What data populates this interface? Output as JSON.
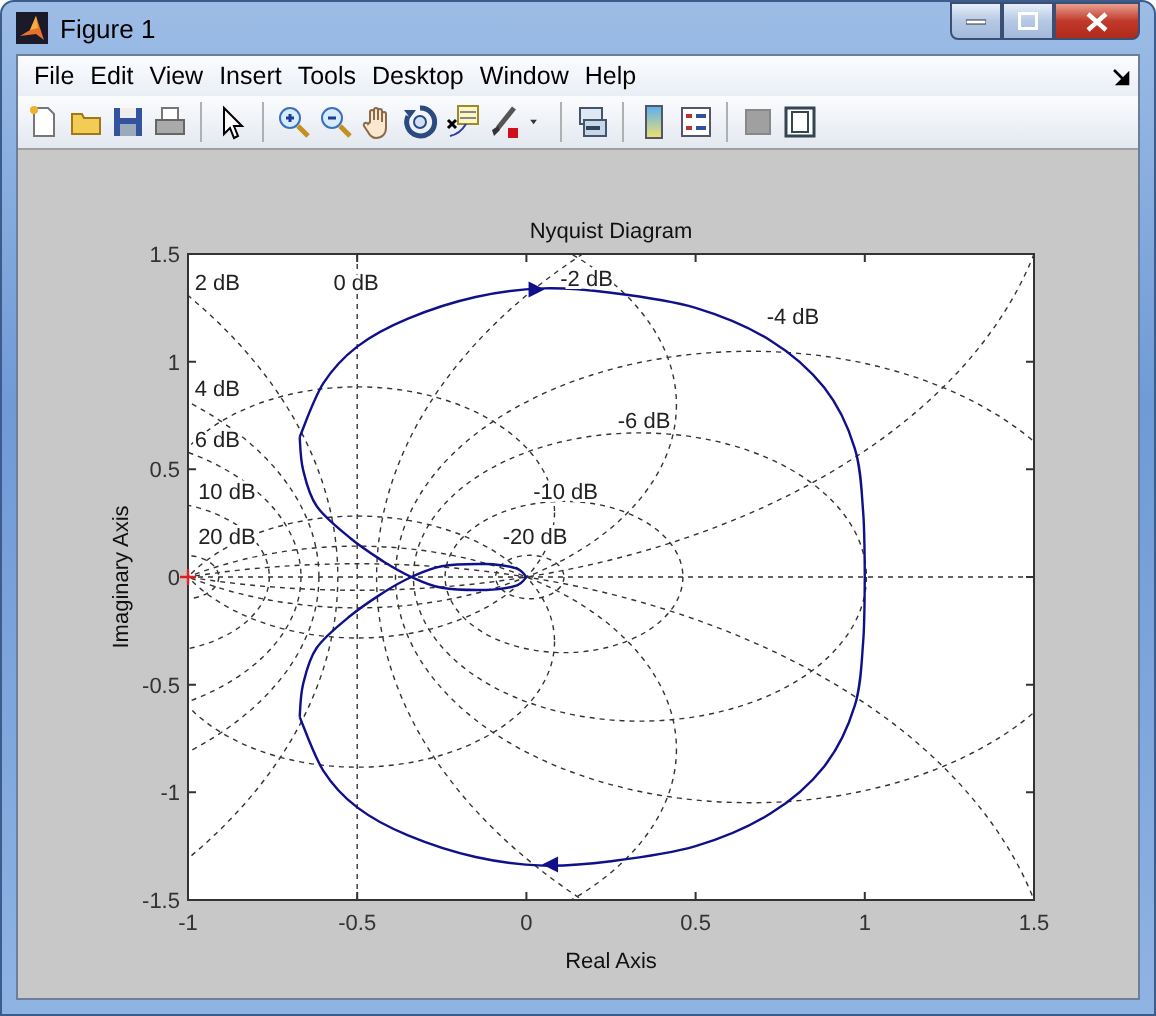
{
  "window": {
    "title": "Figure 1"
  },
  "menu": [
    "File",
    "Edit",
    "View",
    "Insert",
    "Tools",
    "Desktop",
    "Window",
    "Help"
  ],
  "figure": {
    "chart_data": {
      "type": "line",
      "title": "Nyquist Diagram",
      "xlabel": "Real Axis",
      "ylabel": "Imaginary Axis",
      "xlim": [
        -1,
        1.5
      ],
      "ylim": [
        -1.5,
        1.5
      ],
      "xticks": [
        -1,
        -0.5,
        0,
        0.5,
        1,
        1.5
      ],
      "yticks": [
        -1.5,
        -1,
        -0.5,
        0,
        0.5,
        1,
        1.5
      ],
      "series": [
        {
          "color": "#10108a",
          "x": [
            -0.67,
            -0.6,
            -0.5,
            -0.35,
            -0.15,
            0.05,
            0.25,
            0.5,
            0.72,
            0.88,
            0.97,
            0.995,
            1
          ],
          "values": [
            -0.65,
            -0.9,
            -1.07,
            -1.2,
            -1.3,
            -1.34,
            -1.32,
            -1.25,
            -1.1,
            -0.88,
            -0.6,
            -0.3,
            0
          ]
        },
        {
          "color": "#10108a",
          "x": [
            -0.67,
            -0.66,
            -0.62,
            -0.52,
            -0.42,
            -0.34,
            -0.25,
            -0.12,
            -0.03,
            0
          ],
          "values": [
            -0.65,
            -0.5,
            -0.33,
            -0.18,
            -0.07,
            0,
            0.05,
            0.06,
            0.04,
            0
          ]
        },
        {
          "color": "#10108a",
          "x": [
            -0.67,
            -0.66,
            -0.62,
            -0.52,
            -0.42,
            -0.34,
            -0.25,
            -0.12,
            -0.03,
            0
          ],
          "values": [
            0.65,
            0.5,
            0.33,
            0.18,
            0.07,
            0,
            -0.05,
            -0.06,
            -0.04,
            0
          ]
        },
        {
          "color": "#10108a",
          "x": [
            -0.67,
            -0.6,
            -0.5,
            -0.35,
            -0.15,
            0.05,
            0.25,
            0.5,
            0.72,
            0.88,
            0.97,
            0.995,
            1
          ],
          "values": [
            0.65,
            0.9,
            1.07,
            1.2,
            1.3,
            1.34,
            1.32,
            1.25,
            1.1,
            0.88,
            0.6,
            0.3,
            0
          ]
        }
      ],
      "annotations": [
        "2 dB",
        "0 dB",
        "-2 dB",
        "-4 dB",
        "4 dB",
        "-6 dB",
        "6 dB",
        "-10 dB",
        "10 dB",
        "20 dB",
        "-20 dB"
      ]
    }
  }
}
